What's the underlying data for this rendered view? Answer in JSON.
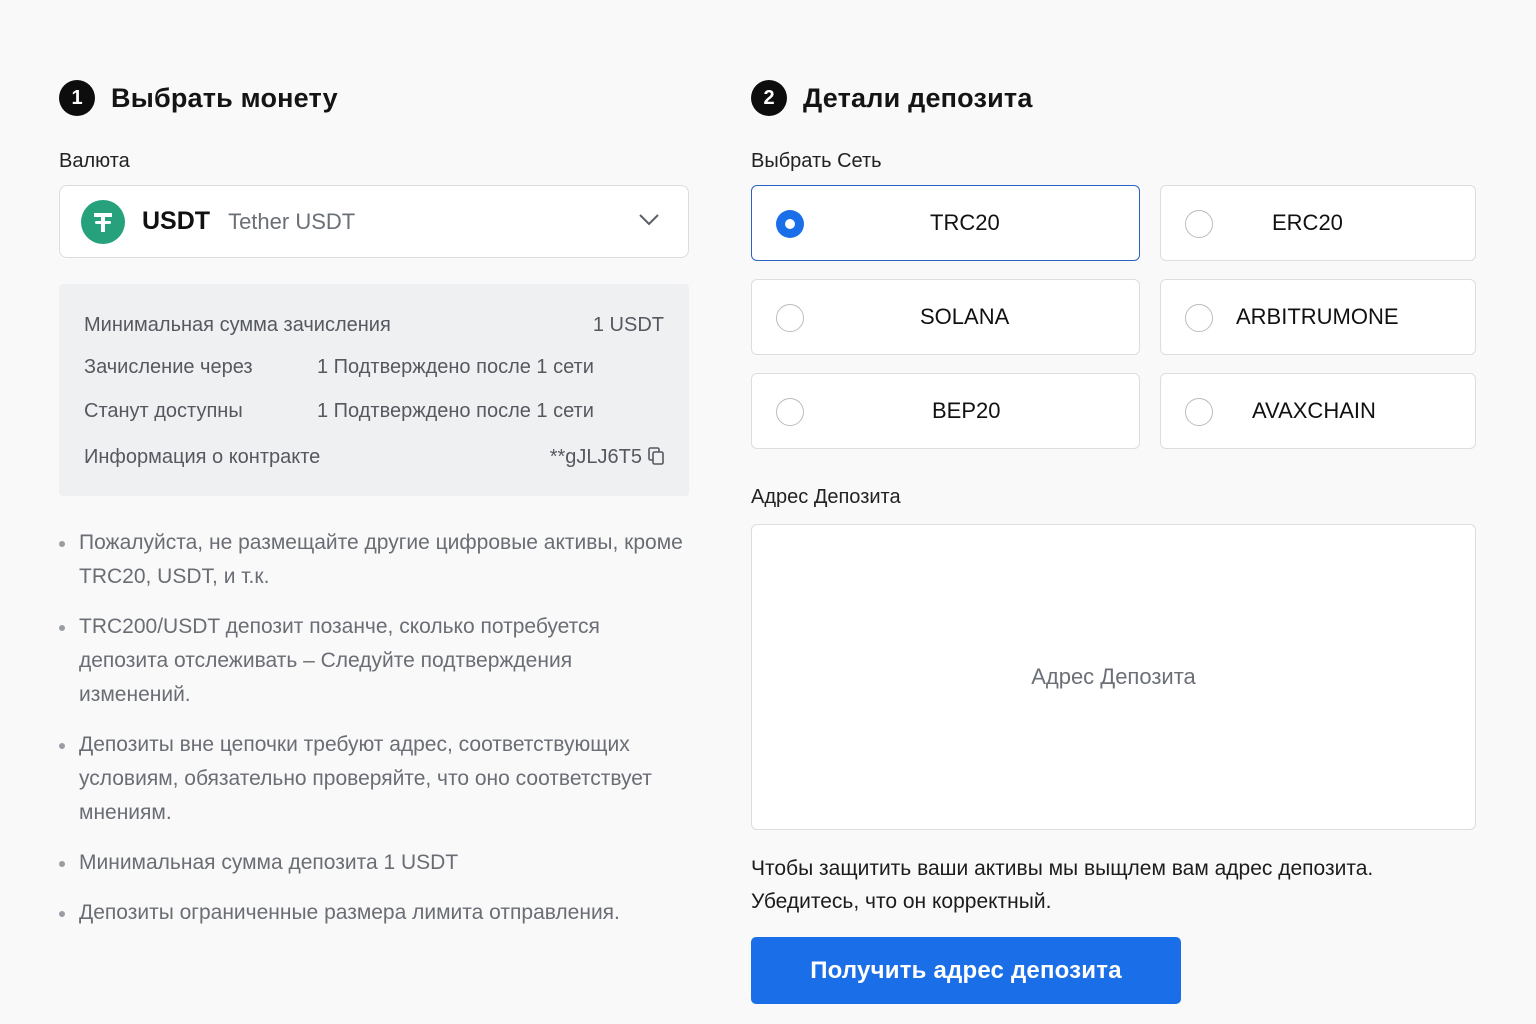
{
  "step1": {
    "number": "1",
    "title": "Выбрать монету",
    "currency_label": "Валюта",
    "coin": {
      "symbol": "USDT",
      "name": "Tether USDT",
      "icon": "tether-icon",
      "icon_color": "#26a17b"
    },
    "info": [
      {
        "key": "Минимальная сумма зачисления",
        "value": "1 USDT"
      },
      {
        "key": "Зачисление через",
        "value": "1 Подтверждено после 1 сети"
      },
      {
        "key": "Станут доступны",
        "value": "1 Подтверждено после 1 сети"
      },
      {
        "key": "Информация о контракте",
        "value": "**gJLJ6T5"
      }
    ],
    "notes": [
      "Пожалуйста, не размещайте другие цифровые активы, кроме TRC20, USDT, и т.к.",
      "TRC200/USDT депозит позанче, сколько потребуется депозита отслеживать – Следуйте подтверждения изменений.",
      "Депозиты вне цепочки требуют адрес, соответствующих условиям, обязательно проверяйте, что оно соответствует мнениям.",
      "Минимальная сумма депозита 1 USDT",
      "Депозиты ограниченные размера лимита отправления."
    ]
  },
  "step2": {
    "number": "2",
    "title": "Детали депозита",
    "network_label": "Выбрать Сеть",
    "networks": [
      {
        "label": "TRC20",
        "selected": true
      },
      {
        "label": "ERC20",
        "selected": false
      },
      {
        "label": "SOLANA",
        "selected": false
      },
      {
        "label": "ARBITRUMONE",
        "selected": false
      },
      {
        "label": "BEP20",
        "selected": false
      },
      {
        "label": "AVAXCHAIN",
        "selected": false
      }
    ],
    "address_label": "Адрес Депозита",
    "address_placeholder": "Адрес Депозита",
    "notice_line1": "Чтобы защитить ваши активы мы выщлем вам адрес депозита.",
    "notice_line2": "Убедитесь, что он корректный.",
    "button_label": "Получить адрес депозита"
  },
  "colors": {
    "accent": "#1a6fe8",
    "selected_border": "#2b63c4",
    "tether_green": "#26a17b"
  }
}
